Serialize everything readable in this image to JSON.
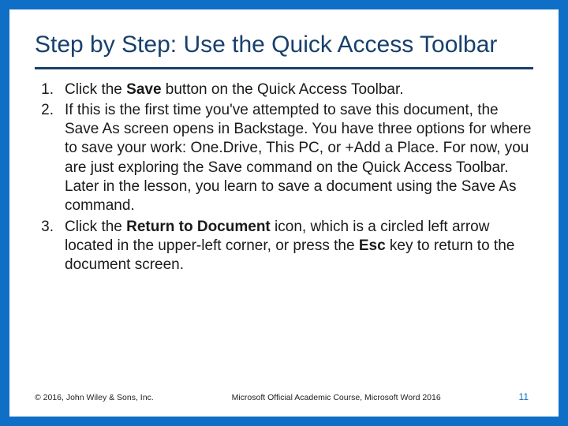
{
  "title": "Step by Step: Use the Quick Access Toolbar",
  "steps": [
    {
      "num": "1.",
      "segments": [
        {
          "t": "Click the "
        },
        {
          "t": "Save",
          "b": true
        },
        {
          "t": " button on the Quick Access Toolbar."
        }
      ]
    },
    {
      "num": "2.",
      "segments": [
        {
          "t": "If this is the first time you've attempted to save this document, the Save As screen opens in Backstage. You have three options for where to save your work: One.Drive, This PC, or  +Add a Place. For now, you are just exploring the Save command on the Quick Access Toolbar. Later in the lesson, you learn to save a document using the Save As command."
        }
      ]
    },
    {
      "num": "3.",
      "segments": [
        {
          "t": "Click the "
        },
        {
          "t": "Return to Document",
          "b": true
        },
        {
          "t": " icon, which is a circled left arrow located in the upper-left corner, or press the "
        },
        {
          "t": "Esc",
          "b": true
        },
        {
          "t": " key to return to the document screen."
        }
      ]
    }
  ],
  "footer": {
    "left": "© 2016, John Wiley & Sons, Inc.",
    "center": "Microsoft Official Academic Course, Microsoft Word 2016",
    "right": "11"
  }
}
